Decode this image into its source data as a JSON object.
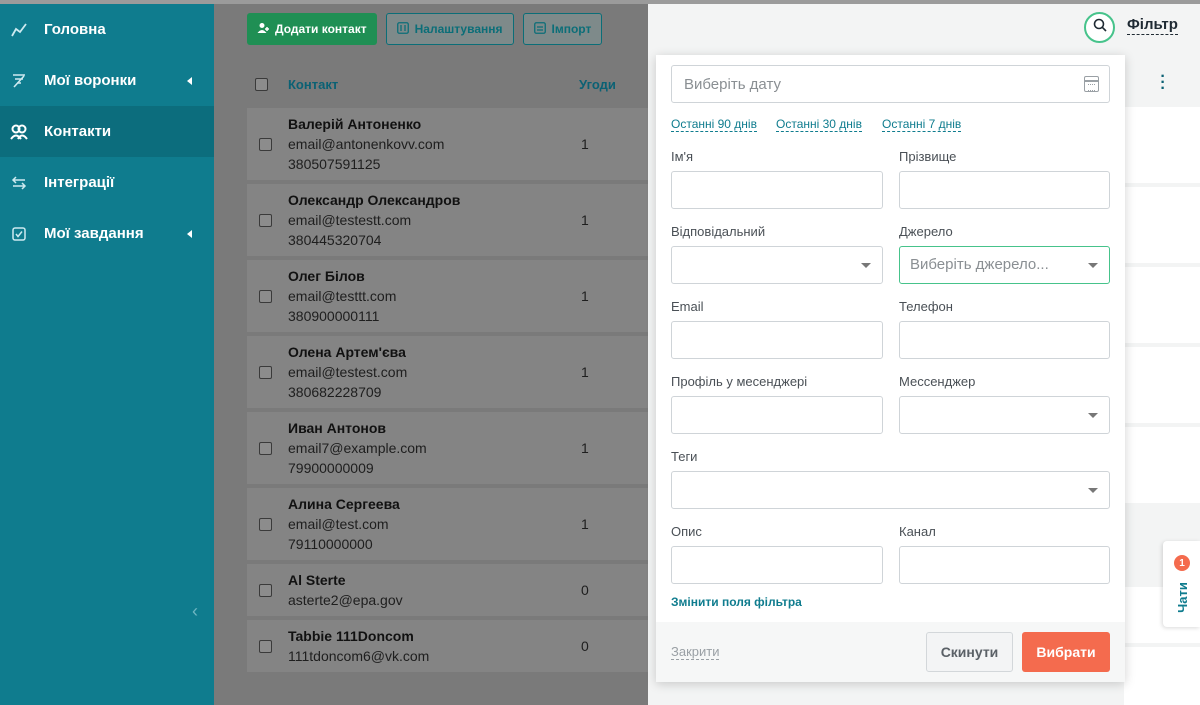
{
  "sidebar": {
    "items": [
      {
        "label": "Головна",
        "icon": "chart-line-icon"
      },
      {
        "label": "Мої воронки",
        "icon": "funnel-icon",
        "has_submenu": true
      },
      {
        "label": "Контакти",
        "icon": "users-icon",
        "active": true
      },
      {
        "label": "Інтеграції",
        "icon": "exchange-icon"
      },
      {
        "label": "Мої завдання",
        "icon": "checkbox-icon",
        "has_submenu": true
      }
    ]
  },
  "toolbar": {
    "add_contact_label": "Додати контакт",
    "settings_label": "Налаштування",
    "import_label": "Імпорт"
  },
  "table": {
    "columns": [
      "Контакт",
      "Угоди"
    ],
    "rows": [
      {
        "name": "Валерій Антоненко",
        "email": "email@antonenkovv.com",
        "phone": "380507591125",
        "deals": "1"
      },
      {
        "name": "Олександр Олександров",
        "email": "email@testestt.com",
        "phone": "380445320704",
        "deals": "1"
      },
      {
        "name": "Олег Білов",
        "email": "email@testtt.com",
        "phone": "380900000111",
        "deals": "1"
      },
      {
        "name": "Олена Артем'єва",
        "email": "email@testest.com",
        "phone": "380682228709",
        "deals": "1"
      },
      {
        "name": "Иван Антонов",
        "email": "email7@example.com",
        "phone": "79900000009",
        "deals": "1"
      },
      {
        "name": "Алина Сергеева",
        "email": "email@test.com",
        "phone": "79110000000",
        "deals": "1"
      },
      {
        "name": "Al Sterte",
        "email": "asterte2@epa.gov",
        "deals": "0"
      },
      {
        "name": "Tabbie 111Doncom",
        "email": "111tdoncom6@vk.com",
        "deals": "0"
      }
    ]
  },
  "filter": {
    "toggle_label": "Фільтр",
    "date_placeholder": "Виберіть дату",
    "quick_ranges": [
      "Останні 90 днів",
      "Останні 30 днів",
      "Останні 7 днів"
    ],
    "first_name_label": "Ім'я",
    "last_name_label": "Прізвище",
    "responsible_label": "Відповідальний",
    "source_label": "Джерело",
    "source_placeholder": "Виберіть джерело...",
    "email_label": "Email",
    "phone_label": "Телефон",
    "messenger_profile_label": "Профіль у месенджері",
    "messenger_label": "Мессенджер",
    "tags_label": "Теги",
    "description_label": "Опис",
    "channel_label": "Канал",
    "change_fields_label": "Змінити поля фільтра",
    "close_label": "Закрити",
    "reset_label": "Скинути",
    "select_label": "Вибрати"
  },
  "chats": {
    "label": "Чати",
    "badge": "1"
  },
  "colors": {
    "sidebar": "#0f7c8e",
    "accent_green": "#1f8f54",
    "primary_button": "#f46b4e",
    "focus_border": "#46c38b"
  }
}
